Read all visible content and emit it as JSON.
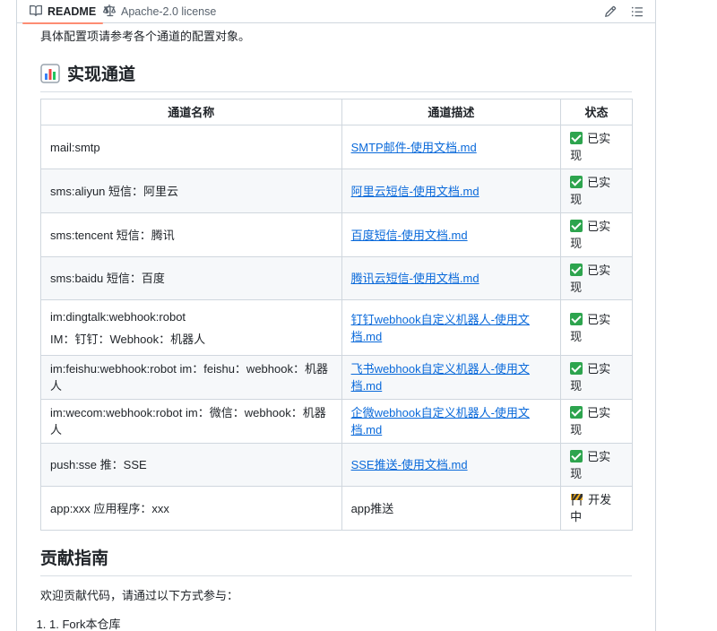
{
  "tabs": {
    "readme": "README",
    "license": "Apache-2.0 license"
  },
  "intro": "具体配置项请参考各个通道的配置对象。",
  "section_impl": {
    "emoji": "bar-chart-emoji",
    "title": "实现通道"
  },
  "table": {
    "headers": [
      "通道名称",
      "通道描述",
      "状态"
    ],
    "rows": [
      {
        "name_l1": "mail:smtp",
        "name_l2": "",
        "desc": "SMTP邮件-使用文档.md",
        "desc_is_link": true,
        "status_icon": "check-mark-icon",
        "status_l1": "已实",
        "status_l2": "现"
      },
      {
        "name_l1": "sms:aliyun  短信：阿里云",
        "name_l2": "",
        "desc": "阿里云短信-使用文档.md",
        "desc_is_link": true,
        "status_icon": "check-mark-icon",
        "status_l1": "已实",
        "status_l2": "现"
      },
      {
        "name_l1": "sms:tencent  短信：腾讯",
        "name_l2": "",
        "desc": "百度短信-使用文档.md",
        "desc_is_link": true,
        "status_icon": "check-mark-icon",
        "status_l1": "已实",
        "status_l2": "现"
      },
      {
        "name_l1": "sms:baidu  短信：百度",
        "name_l2": "",
        "desc": "腾讯云短信-使用文档.md",
        "desc_is_link": true,
        "status_icon": "check-mark-icon",
        "status_l1": "已实",
        "status_l2": "现"
      },
      {
        "name_l1": "im:dingtalk:webhook:robot",
        "name_l2": "IM：钉钉：Webhook：机器人",
        "desc": "钉钉webhook自定义机器人-使用文档.md",
        "desc_is_link": true,
        "status_icon": "check-mark-icon",
        "status_l1": "已实",
        "status_l2": "现"
      },
      {
        "name_l1": "im:feishu:webhook:robot  im：feishu：webhook：机器人",
        "name_l2": "",
        "desc": "飞书webhook自定义机器人-使用文档.md",
        "desc_is_link": true,
        "status_icon": "check-mark-icon",
        "status_l1": "已实",
        "status_l2": "现"
      },
      {
        "name_l1": "im:wecom:webhook:robot  im：微信：webhook：机器人",
        "name_l2": "",
        "desc": "企微webhook自定义机器人-使用文档.md",
        "desc_is_link": true,
        "status_icon": "check-mark-icon",
        "status_l1": "已实",
        "status_l2": "现"
      },
      {
        "name_l1": "push:sse  推：SSE",
        "name_l2": "",
        "desc": "SSE推送-使用文档.md",
        "desc_is_link": true,
        "status_icon": "check-mark-icon",
        "status_l1": "已实",
        "status_l2": "现"
      },
      {
        "name_l1": "app:xxx  应用程序：xxx",
        "name_l2": "",
        "desc": "app推送",
        "desc_is_link": false,
        "status_icon": "construction-icon",
        "status_l1": "开发",
        "status_l2": "中"
      }
    ]
  },
  "section_contrib": {
    "title": "贡献指南",
    "text": "欢迎贡献代码，请通过以下方式参与：",
    "list": [
      "Fork本仓库"
    ]
  },
  "colors": {
    "link": "#0969da",
    "check": "#2da44e",
    "tab_underline": "#fd8c73",
    "border": "#d0d7de"
  }
}
